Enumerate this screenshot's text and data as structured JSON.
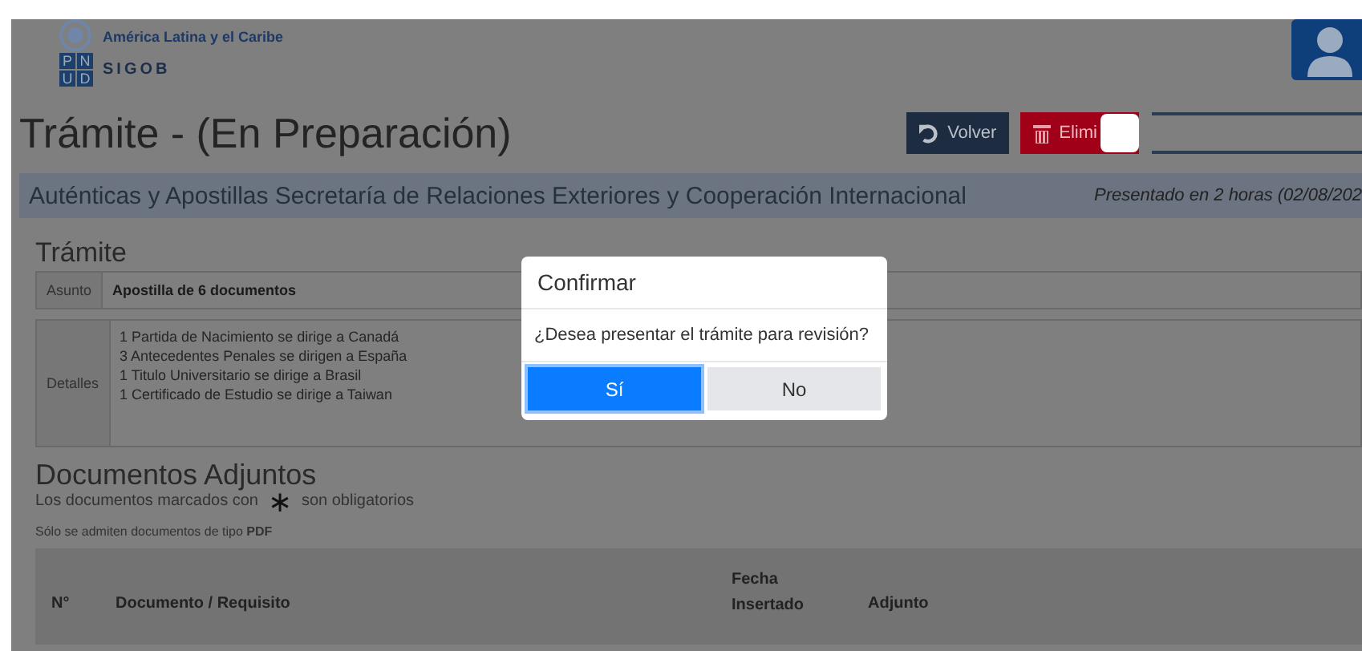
{
  "header": {
    "org_letters": [
      "P",
      "N",
      "U",
      "D"
    ],
    "region": "América Latina y el Caribe",
    "product": "SIGOB"
  },
  "title": "Trámite - (En Preparación)",
  "toolbar": {
    "buttons": [
      {
        "label": "Volver",
        "kind": "back"
      },
      {
        "label": "Elimi",
        "kind": "delete"
      }
    ]
  },
  "band": {
    "office": "Auténticas y Apostillas Secretaría de Relaciones Exteriores y Cooperación Internacional",
    "presented": "Presentado en 2 horas (02/08/202"
  },
  "tramite": {
    "heading": "Trámite",
    "subject_label": "Asunto",
    "subject": "Apostilla de 6 documentos",
    "details_label": "Detalles",
    "details": [
      "1 Partida de Nacimiento se dirige a Canadá",
      "3 Antecedentes Penales se dirigen a España",
      "1 Titulo Universitario se dirige a Brasil",
      "1 Certificado de Estudio se dirige a Taiwan"
    ]
  },
  "documents": {
    "heading": "Documentos Adjuntos",
    "note_before": "Los documentos marcados con",
    "note_mark": "∗",
    "note_after": "son obligatorios",
    "hint": "Sólo se admiten documentos de tipo **PDF**",
    "columns": [
      "N°",
      "Documento / Requisito",
      "Fecha Insertado",
      "Adjunto"
    ]
  },
  "dialog": {
    "title": "Confirmar",
    "message": "¿Desea presentar el trámite para revisión?",
    "buttons": [
      {
        "label": "Sí",
        "selected": true
      },
      {
        "label": "No",
        "selected": false
      }
    ]
  }
}
